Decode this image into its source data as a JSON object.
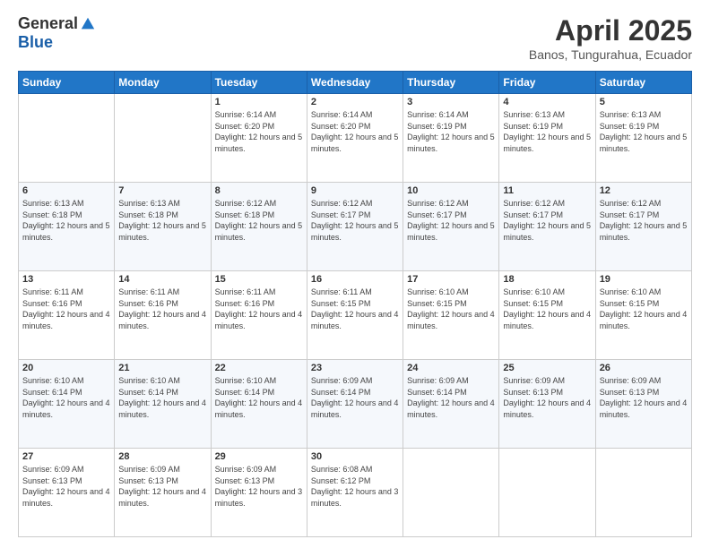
{
  "logo": {
    "general": "General",
    "blue": "Blue"
  },
  "title": "April 2025",
  "subtitle": "Banos, Tungurahua, Ecuador",
  "days_header": [
    "Sunday",
    "Monday",
    "Tuesday",
    "Wednesday",
    "Thursday",
    "Friday",
    "Saturday"
  ],
  "weeks": [
    [
      {
        "day": "",
        "info": ""
      },
      {
        "day": "",
        "info": ""
      },
      {
        "day": "1",
        "info": "Sunrise: 6:14 AM\nSunset: 6:20 PM\nDaylight: 12 hours and 5 minutes."
      },
      {
        "day": "2",
        "info": "Sunrise: 6:14 AM\nSunset: 6:20 PM\nDaylight: 12 hours and 5 minutes."
      },
      {
        "day": "3",
        "info": "Sunrise: 6:14 AM\nSunset: 6:19 PM\nDaylight: 12 hours and 5 minutes."
      },
      {
        "day": "4",
        "info": "Sunrise: 6:13 AM\nSunset: 6:19 PM\nDaylight: 12 hours and 5 minutes."
      },
      {
        "day": "5",
        "info": "Sunrise: 6:13 AM\nSunset: 6:19 PM\nDaylight: 12 hours and 5 minutes."
      }
    ],
    [
      {
        "day": "6",
        "info": "Sunrise: 6:13 AM\nSunset: 6:18 PM\nDaylight: 12 hours and 5 minutes."
      },
      {
        "day": "7",
        "info": "Sunrise: 6:13 AM\nSunset: 6:18 PM\nDaylight: 12 hours and 5 minutes."
      },
      {
        "day": "8",
        "info": "Sunrise: 6:12 AM\nSunset: 6:18 PM\nDaylight: 12 hours and 5 minutes."
      },
      {
        "day": "9",
        "info": "Sunrise: 6:12 AM\nSunset: 6:17 PM\nDaylight: 12 hours and 5 minutes."
      },
      {
        "day": "10",
        "info": "Sunrise: 6:12 AM\nSunset: 6:17 PM\nDaylight: 12 hours and 5 minutes."
      },
      {
        "day": "11",
        "info": "Sunrise: 6:12 AM\nSunset: 6:17 PM\nDaylight: 12 hours and 5 minutes."
      },
      {
        "day": "12",
        "info": "Sunrise: 6:12 AM\nSunset: 6:17 PM\nDaylight: 12 hours and 5 minutes."
      }
    ],
    [
      {
        "day": "13",
        "info": "Sunrise: 6:11 AM\nSunset: 6:16 PM\nDaylight: 12 hours and 4 minutes."
      },
      {
        "day": "14",
        "info": "Sunrise: 6:11 AM\nSunset: 6:16 PM\nDaylight: 12 hours and 4 minutes."
      },
      {
        "day": "15",
        "info": "Sunrise: 6:11 AM\nSunset: 6:16 PM\nDaylight: 12 hours and 4 minutes."
      },
      {
        "day": "16",
        "info": "Sunrise: 6:11 AM\nSunset: 6:15 PM\nDaylight: 12 hours and 4 minutes."
      },
      {
        "day": "17",
        "info": "Sunrise: 6:10 AM\nSunset: 6:15 PM\nDaylight: 12 hours and 4 minutes."
      },
      {
        "day": "18",
        "info": "Sunrise: 6:10 AM\nSunset: 6:15 PM\nDaylight: 12 hours and 4 minutes."
      },
      {
        "day": "19",
        "info": "Sunrise: 6:10 AM\nSunset: 6:15 PM\nDaylight: 12 hours and 4 minutes."
      }
    ],
    [
      {
        "day": "20",
        "info": "Sunrise: 6:10 AM\nSunset: 6:14 PM\nDaylight: 12 hours and 4 minutes."
      },
      {
        "day": "21",
        "info": "Sunrise: 6:10 AM\nSunset: 6:14 PM\nDaylight: 12 hours and 4 minutes."
      },
      {
        "day": "22",
        "info": "Sunrise: 6:10 AM\nSunset: 6:14 PM\nDaylight: 12 hours and 4 minutes."
      },
      {
        "day": "23",
        "info": "Sunrise: 6:09 AM\nSunset: 6:14 PM\nDaylight: 12 hours and 4 minutes."
      },
      {
        "day": "24",
        "info": "Sunrise: 6:09 AM\nSunset: 6:14 PM\nDaylight: 12 hours and 4 minutes."
      },
      {
        "day": "25",
        "info": "Sunrise: 6:09 AM\nSunset: 6:13 PM\nDaylight: 12 hours and 4 minutes."
      },
      {
        "day": "26",
        "info": "Sunrise: 6:09 AM\nSunset: 6:13 PM\nDaylight: 12 hours and 4 minutes."
      }
    ],
    [
      {
        "day": "27",
        "info": "Sunrise: 6:09 AM\nSunset: 6:13 PM\nDaylight: 12 hours and 4 minutes."
      },
      {
        "day": "28",
        "info": "Sunrise: 6:09 AM\nSunset: 6:13 PM\nDaylight: 12 hours and 4 minutes."
      },
      {
        "day": "29",
        "info": "Sunrise: 6:09 AM\nSunset: 6:13 PM\nDaylight: 12 hours and 3 minutes."
      },
      {
        "day": "30",
        "info": "Sunrise: 6:08 AM\nSunset: 6:12 PM\nDaylight: 12 hours and 3 minutes."
      },
      {
        "day": "",
        "info": ""
      },
      {
        "day": "",
        "info": ""
      },
      {
        "day": "",
        "info": ""
      }
    ]
  ]
}
